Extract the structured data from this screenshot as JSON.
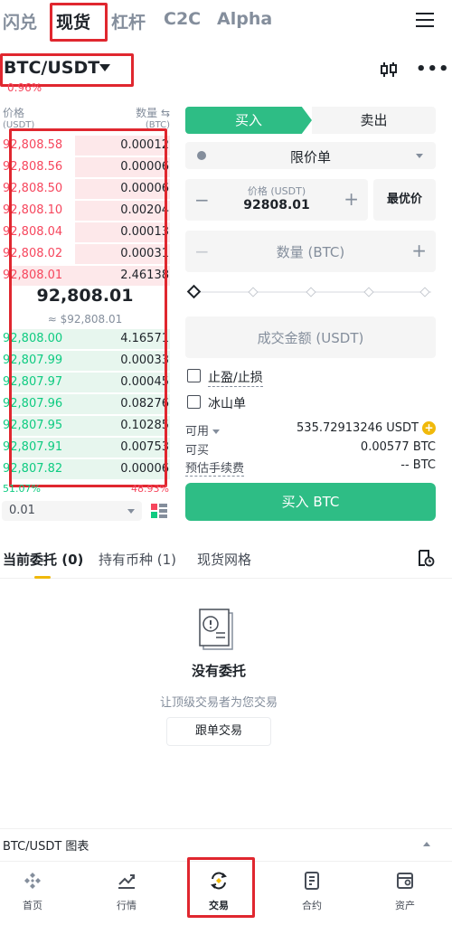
{
  "top_tabs": [
    "闪兑",
    "现货",
    "杠杆",
    "C2C",
    "Alpha"
  ],
  "pair": {
    "symbol": "BTC/USDT",
    "change": "0.96%"
  },
  "order_book": {
    "price_header": "价格",
    "price_unit": "(USDT)",
    "qty_header": "数量",
    "qty_unit": "(BTC)",
    "asks": [
      {
        "price": "92,808.58",
        "qty": "0.00012",
        "depth": 0.55
      },
      {
        "price": "92,808.56",
        "qty": "0.00006",
        "depth": 0.55
      },
      {
        "price": "92,808.50",
        "qty": "0.00006",
        "depth": 0.55
      },
      {
        "price": "92,808.10",
        "qty": "0.00204",
        "depth": 0.55
      },
      {
        "price": "92,808.04",
        "qty": "0.00013",
        "depth": 0.55
      },
      {
        "price": "92,808.02",
        "qty": "0.00031",
        "depth": 0.55
      },
      {
        "price": "92,808.01",
        "qty": "2.46138",
        "depth": 0.98
      }
    ],
    "mid_price": "92,808.01",
    "mid_fiat": "≈ $92,808.01",
    "bids": [
      {
        "price": "92,808.00",
        "qty": "4.16571",
        "depth": 0.98
      },
      {
        "price": "92,807.99",
        "qty": "0.00033",
        "depth": 0.98
      },
      {
        "price": "92,807.97",
        "qty": "0.00045",
        "depth": 0.98
      },
      {
        "price": "92,807.96",
        "qty": "0.08276",
        "depth": 0.98
      },
      {
        "price": "92,807.95",
        "qty": "0.10285",
        "depth": 0.98
      },
      {
        "price": "92,807.91",
        "qty": "0.00753",
        "depth": 0.98
      },
      {
        "price": "92,807.82",
        "qty": "0.00006",
        "depth": 0.98
      }
    ],
    "buy_ratio": "51.07%",
    "sell_ratio": "48.93%",
    "precision": "0.01"
  },
  "order_form": {
    "buy_tab": "买入",
    "sell_tab": "卖出",
    "order_type": "限价单",
    "price_label": "价格 (USDT)",
    "price_value": "92808.01",
    "best_price": "最优价",
    "qty_placeholder": "数量 (BTC)",
    "total_placeholder": "成交金额 (USDT)",
    "tp_sl": "止盈/止损",
    "iceberg": "冰山单",
    "available_label": "可用",
    "available_value": "535.72913246 USDT",
    "can_buy_label": "可买",
    "can_buy_value": "0.00577 BTC",
    "fee_label": "预估手续费",
    "fee_value": "-- BTC",
    "submit": "买入 BTC"
  },
  "orders": {
    "tabs": [
      "当前委托 (0)",
      "持有币种 (1)",
      "现货网格"
    ],
    "empty_title": "没有委托",
    "empty_sub": "让顶级交易者为您交易",
    "copy_btn": "跟单交易"
  },
  "chart_bar": "BTC/USDT 图表",
  "nav": [
    "首页",
    "行情",
    "交易",
    "合约",
    "资产"
  ],
  "colors": {
    "buy": "#2ebd85",
    "sell": "#f6465d",
    "accent": "#f0b90b"
  }
}
